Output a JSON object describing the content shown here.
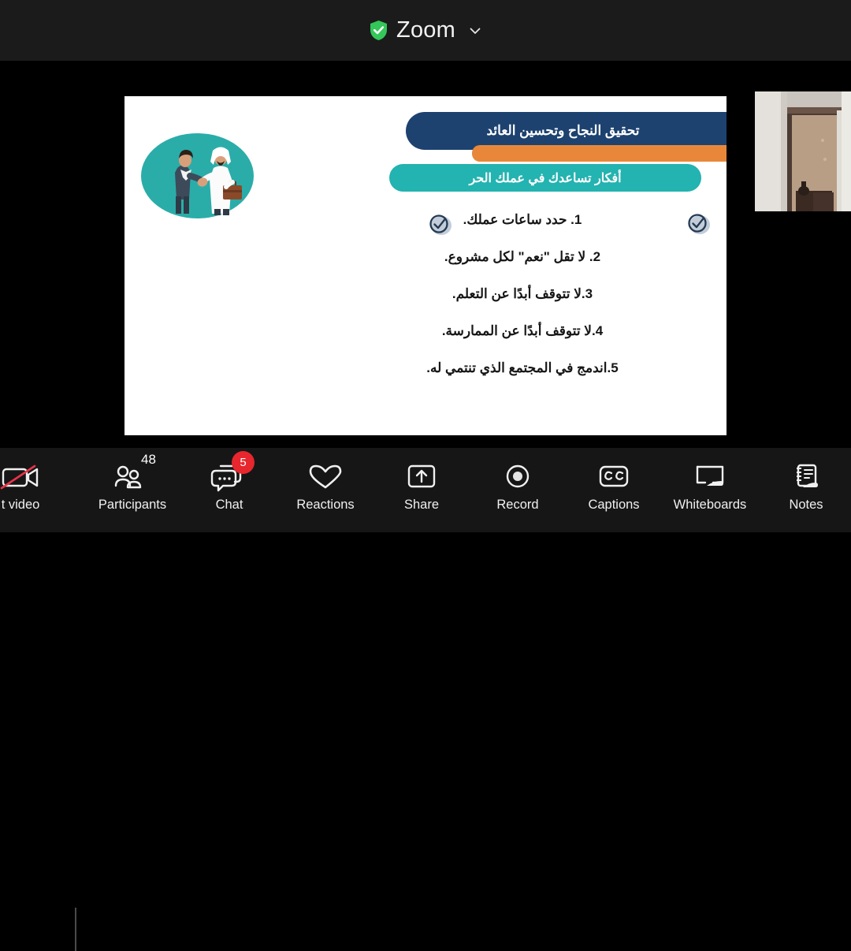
{
  "titlebar": {
    "app_name": "Zoom",
    "shield_icon": "shield-check-icon",
    "chevron_icon": "chevron-down-icon",
    "accent_green": "#34c759"
  },
  "slide": {
    "banner_title": "تحقيق النجاح وتحسين العائد",
    "banner_subtitle": "أفكار تساعدك في عملك الحر",
    "colors": {
      "navy": "#1d4270",
      "orange": "#e8873a",
      "teal": "#23b3b0",
      "background": "#ffffff"
    },
    "illustration": {
      "name": "handshake-businessmen-illustration",
      "circle_color": "#2aada9"
    },
    "check_badges": [
      {
        "name": "check-badge-left"
      },
      {
        "name": "check-badge-right"
      }
    ],
    "list": [
      "1. حدد ساعات عملك.",
      "2. لا تقل \"نعم\" لكل مشروع.",
      "3.لا تتوقف أبدًا عن التعلم.",
      "4.لا تتوقف أبدًا عن الممارسة.",
      "5.اندمج في المجتمع الذي تنتمي له."
    ]
  },
  "thumbnail": {
    "name": "participant-video-thumbnail"
  },
  "toolbar": {
    "items": [
      {
        "label": "t video",
        "icon": "video-off-icon",
        "badge": null,
        "count": null
      },
      {
        "label": "Participants",
        "icon": "participants-icon",
        "badge": null,
        "count": "48"
      },
      {
        "label": "Chat",
        "icon": "chat-icon",
        "badge": "5",
        "count": null
      },
      {
        "label": "Reactions",
        "icon": "heart-icon",
        "badge": null,
        "count": null
      },
      {
        "label": "Share",
        "icon": "share-screen-icon",
        "badge": null,
        "count": null
      },
      {
        "label": "Record",
        "icon": "record-icon",
        "badge": null,
        "count": null
      },
      {
        "label": "Captions",
        "icon": "closed-captions-icon",
        "badge": null,
        "count": null
      },
      {
        "label": "Whiteboards",
        "icon": "whiteboard-icon",
        "badge": null,
        "count": null
      },
      {
        "label": "Notes",
        "icon": "notes-icon",
        "badge": null,
        "count": null
      }
    ],
    "badge_color": "#e8262d",
    "video_off_slash_color": "#e8334a"
  }
}
